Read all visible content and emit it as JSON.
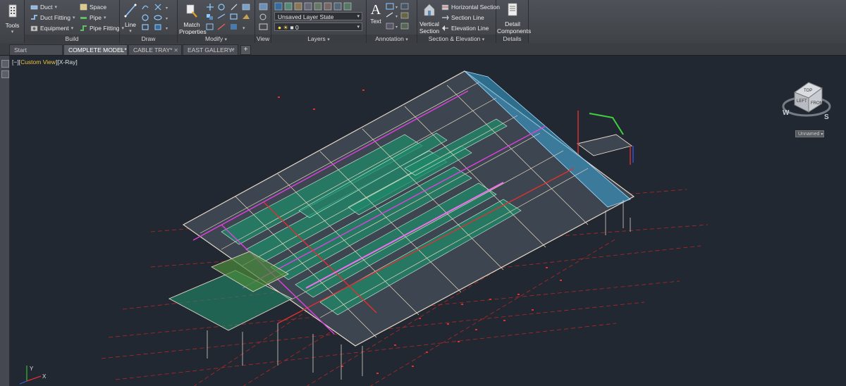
{
  "ribbon": {
    "tools": {
      "label": "Tools"
    },
    "build": {
      "title": "Build",
      "items": [
        {
          "label": "Duct",
          "icon": "duct-icon"
        },
        {
          "label": "Duct Fitting",
          "icon": "duct-fitting-icon"
        },
        {
          "label": "Equipment",
          "icon": "equipment-icon"
        },
        {
          "label": "Space",
          "icon": "space-icon"
        },
        {
          "label": "Pipe",
          "icon": "pipe-icon"
        },
        {
          "label": "Pipe Fitting",
          "icon": "pipe-fitting-icon"
        }
      ]
    },
    "draw": {
      "title": "Draw",
      "line_label": "Line"
    },
    "modify": {
      "title": "Modify",
      "match_label_1": "Match",
      "match_label_2": "Properties"
    },
    "view": {
      "title": "View"
    },
    "layers": {
      "title": "Layers",
      "layer_state": "Unsaved Layer State",
      "current_layer": "0"
    },
    "annotation": {
      "title": "Annotation",
      "text_label": "Text"
    },
    "section": {
      "title": "Section & Elevation",
      "vertical_1": "Vertical",
      "vertical_2": "Section",
      "horizontal": "Horizontal Section",
      "section_line": "Section Line",
      "elevation_line": "Elevation Line"
    },
    "details": {
      "title": "Details",
      "label_1": "Detail",
      "label_2": "Components"
    }
  },
  "tabs": [
    {
      "label": "Start",
      "active": false
    },
    {
      "label": "COMPLETE MODEL*",
      "active": true
    },
    {
      "label": "CABLE TRAY*",
      "active": false
    },
    {
      "label": "EAST GALLERY*",
      "active": false
    }
  ],
  "viewport": {
    "control_prefix": "[−][",
    "view_name": "Custom View",
    "visual_style": "][X-Ray]",
    "viewcube": {
      "top": "TOP",
      "front": "FRONT",
      "left": "LEFT",
      "west": "W",
      "south": "S",
      "ucs_label": "Unnamed"
    }
  },
  "colors": {
    "accent_view": "#f0c040",
    "model_green": "#1f8a6a",
    "model_blue": "#3aa6d8",
    "model_magenta": "#e040e0",
    "model_red": "#e03030"
  }
}
